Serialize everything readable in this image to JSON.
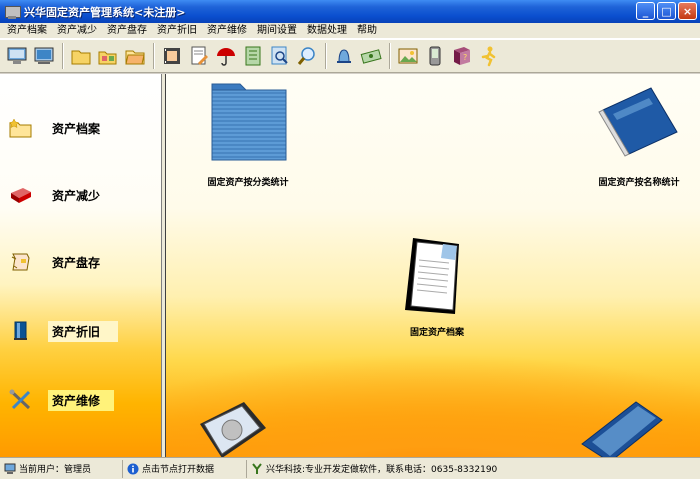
{
  "window": {
    "title": "兴华固定资产管理系统<未注册>",
    "minimize_glyph": "_",
    "maximize_glyph": "□",
    "close_glyph": "×"
  },
  "menu": [
    "资产档案",
    "资产减少",
    "资产盘存",
    "资产折旧",
    "资产维修",
    "期间设置",
    "数据处理",
    "帮助"
  ],
  "toolbar_icons": [
    "computer-icon",
    "monitor-icon",
    "folder-icon",
    "folder-exchange-icon",
    "folder-open-icon",
    "film-icon",
    "edit-document-icon",
    "umbrella-icon",
    "notebook-icon",
    "search-document-icon",
    "magnifier-icon",
    "bell-icon",
    "money-icon",
    "picture-icon",
    "pda-icon",
    "help-book-icon",
    "exit-runner-icon"
  ],
  "nav": [
    {
      "label": "资产档案",
      "icon": "folder-star-icon"
    },
    {
      "label": "资产减少",
      "icon": "book-red-icon"
    },
    {
      "label": "资产盘存",
      "icon": "scroll-icon"
    },
    {
      "label": "资产折旧",
      "icon": "blue-book-icon"
    },
    {
      "label": "资产维修",
      "icon": "tools-icon"
    }
  ],
  "main_items": [
    {
      "label": "固定资产按分类统计",
      "icon": "blue-folder-icon"
    },
    {
      "label": "固定资产按名称统计",
      "icon": "blue-binder-icon"
    },
    {
      "label": "固定资产档案",
      "icon": "document-icon"
    }
  ],
  "status": {
    "user": "当前用户：管理员",
    "hint": "点击节点打开数据",
    "company": "兴华科技:专业开发定做软件，联系电话：0635-8332190"
  },
  "colors": {
    "titlebar": "#0a4fcf",
    "panel_gradient_top": "#ffffff",
    "panel_gradient_bottom": "#ff9a00"
  }
}
